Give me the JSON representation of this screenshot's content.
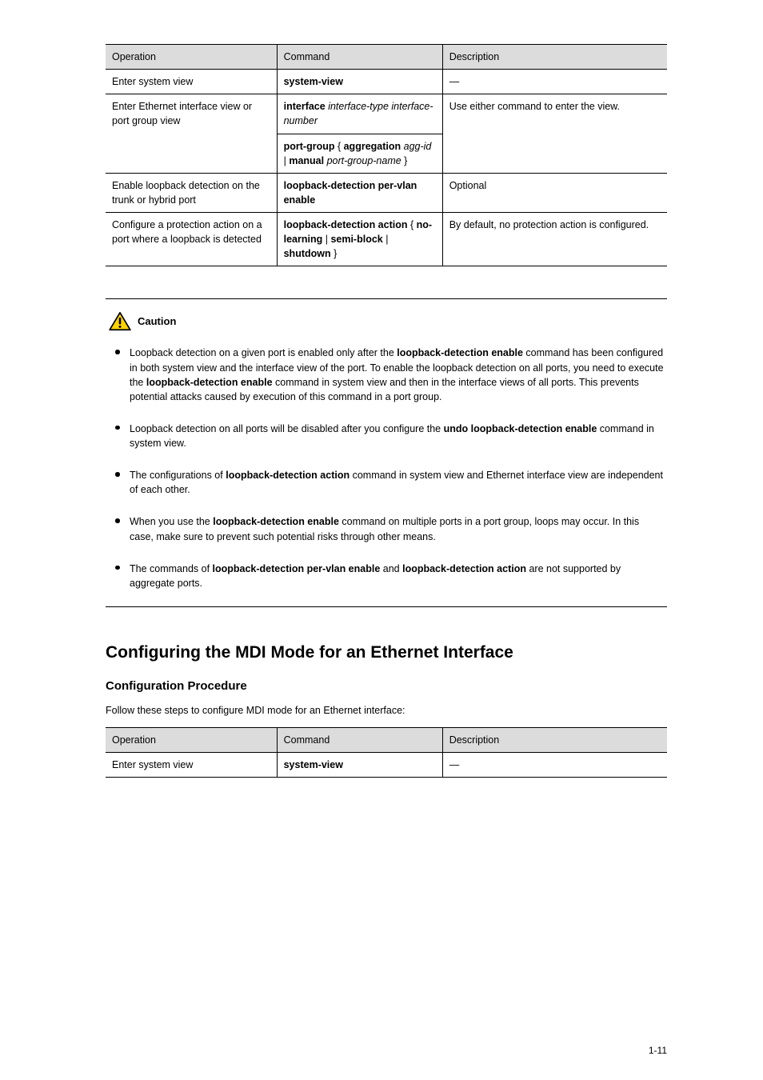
{
  "table1": {
    "headers": [
      "Operation",
      "Command",
      "Description"
    ],
    "rows": [
      {
        "op": "Enter system view",
        "cmd_html": "<span class='cmd-text'>system-view</span>",
        "desc": "—"
      },
      {
        "op": "Enter Ethernet interface view or port group view",
        "cmd_html": "<span class='cmd-text'>interface</span> <span class='cmd-arg'>interface-type interface-number</span>",
        "desc": "Use either command to enter the view."
      },
      {
        "op": "",
        "cmd_html": "<span class='cmd-text'>port-group</span> { <span class='cmd-text'>aggregation</span> <span class='cmd-arg'>agg-id</span> | <span class='cmd-text'>manual</span> <span class='cmd-arg'>port-group-name</span> }",
        "desc": ""
      },
      {
        "op": "Enable loopback detection on the trunk or hybrid port",
        "cmd_html": "<span class='cmd-text'>loopback-detection per-vlan enable</span>",
        "desc": "Optional"
      },
      {
        "op": "Configure a protection action on a port where a loopback is detected",
        "cmd_html": "<span class='cmd-text'>loopback-detection action</span> { <span class='cmd-text'>no-learning</span> | <span class='cmd-text'>semi-block</span> | <span class='cmd-text'>shutdown</span> }",
        "desc": "By default, no protection action is configured."
      }
    ],
    "rowspan3": true
  },
  "caution": {
    "title": "Caution",
    "items": [
      "Loopback detection on a given port is enabled only after the <span class='key-bold'>loopback-detection enable</span> command has been configured in both system view and the interface view of the port. To enable the loopback detection on all ports, you need to execute the <span class='key-bold'>loopback-detection enable</span> command in system view and then in the interface views of all ports. This prevents potential attacks caused by execution of this command in a port group.",
      "Loopback detection on all ports will be disabled after you configure the <span class='key-bold'>undo loopback-detection enable</span> command in system view.",
      "The configurations of <span class='key-bold'>loopback-detection action</span> command in system view and Ethernet interface view are independent of each other.",
      "When you use the <span class='key-bold'>loopback-detection enable</span> command on multiple ports in a port group, loops may occur. In this case, make sure to prevent such potential risks through other means.",
      "The commands of <span class='key-bold'>loopback-detection per-vlan enable</span> and <span class='key-bold'>loopback-detection action</span> are not supported by aggregate ports."
    ]
  },
  "section": {
    "h2": "Configuring the MDI Mode for an Ethernet Interface",
    "h3": "Configuration Procedure",
    "intro": "Follow these steps to configure MDI mode for an Ethernet interface:"
  },
  "table2": {
    "headers": [
      "Operation",
      "Command",
      "Description"
    ],
    "rows": [
      {
        "op": "Enter system view",
        "cmd_html": "<span class='cmd-text'>system-view</span>",
        "desc": "—"
      }
    ]
  },
  "page_number": "1-11"
}
